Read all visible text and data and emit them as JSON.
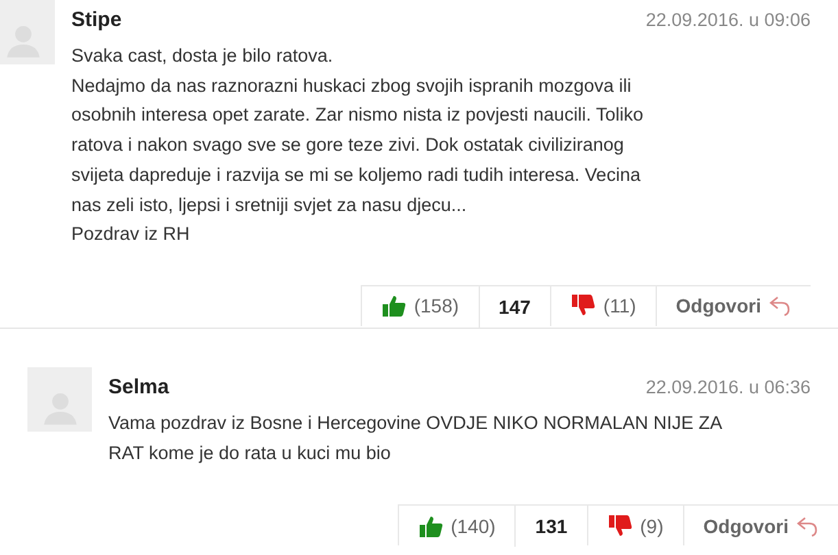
{
  "comments": [
    {
      "author": "Stipe",
      "date": "22.09.2016. u 09:06",
      "lines": [
        "Svaka cast, dosta je bilo ratova.",
        "Nedajmo da nas raznorazni huskaci zbog svojih ispranih mozgova ili",
        "osobnih interesa opet zarate. Zar nismo nista iz povjesti naucili. Toliko",
        "ratova i nakon svago sve se gore teze zivi. Dok ostatak civiliziranog",
        "svijeta dapreduje i razvija se mi se koljemo radi tudih interesa. Vecina",
        "nas zeli isto, ljepsi i sretniji svjet za nasu djecu...",
        "Pozdrav iz RH"
      ],
      "likes": "(158)",
      "score": "147",
      "dislikes": "(11)",
      "reply": "Odgovori"
    },
    {
      "author": "Selma",
      "date": "22.09.2016. u 06:36",
      "lines": [
        "Vama pozdrav iz Bosne i Hercegovine OVDJE NIKO NORMALAN NIJE ZA",
        "RAT kome je do rata u kuci mu bio"
      ],
      "likes": "(140)",
      "score": "131",
      "dislikes": "(9)",
      "reply": "Odgovori"
    }
  ]
}
